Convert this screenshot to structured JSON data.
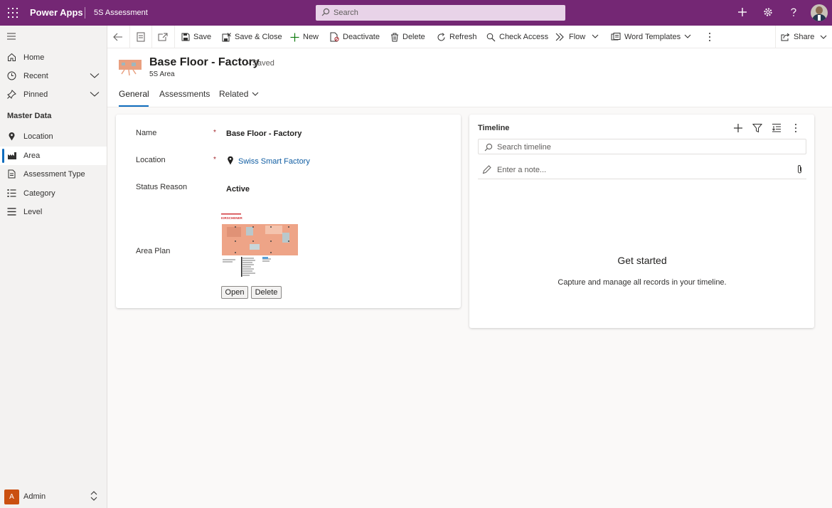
{
  "app": {
    "brand": "Power Apps",
    "name": "5S Assessment"
  },
  "search": {
    "placeholder": "Search"
  },
  "sidebar": {
    "items": [
      {
        "label": "Home"
      },
      {
        "label": "Recent"
      },
      {
        "label": "Pinned"
      }
    ],
    "section": "Master Data",
    "master": [
      {
        "label": "Location"
      },
      {
        "label": "Area"
      },
      {
        "label": "Assessment Type"
      },
      {
        "label": "Category"
      },
      {
        "label": "Level"
      }
    ],
    "user": {
      "initial": "A",
      "label": "Admin"
    }
  },
  "commands": {
    "save": "Save",
    "save_close": "Save & Close",
    "new": "New",
    "deactivate": "Deactivate",
    "delete": "Delete",
    "refresh": "Refresh",
    "check_access": "Check Access",
    "flow": "Flow",
    "word_templates": "Word Templates",
    "share": "Share"
  },
  "record": {
    "title": "Base Floor - Factory",
    "status": "- Saved",
    "entity": "5S Area"
  },
  "tabs": [
    {
      "label": "General"
    },
    {
      "label": "Assessments"
    },
    {
      "label": "Related"
    }
  ],
  "form": {
    "name_label": "Name",
    "name_value": "Base Floor - Factory",
    "location_label": "Location",
    "location_value": "Swiss Smart Factory",
    "status_label": "Status Reason",
    "status_value": "Active",
    "plan_label": "Area Plan",
    "plan_brand": "KIRSCHENER",
    "open_btn": "Open",
    "delete_btn": "Delete",
    "required_mark": "*"
  },
  "timeline": {
    "title": "Timeline",
    "search_placeholder": "Search timeline",
    "note_placeholder": "Enter a note...",
    "empty_title": "Get started",
    "empty_text": "Capture and manage all records in your timeline."
  },
  "colors": {
    "header": "#742774",
    "accent": "#0f6cbd",
    "link": "#115ea3"
  }
}
